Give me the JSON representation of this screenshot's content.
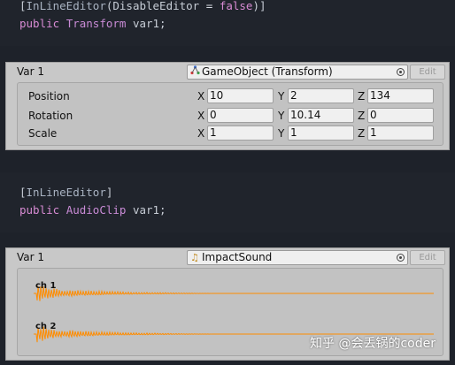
{
  "code1": {
    "attribute": "InLineEditor",
    "param_name": "DisableEditor",
    "param_op": "=",
    "param_value": "false",
    "keyword": "public",
    "type": "Transform",
    "var": "var1;"
  },
  "panel1": {
    "label": "Var 1",
    "object_field": "GameObject (Transform)",
    "object_icon": "transform-icon",
    "edit_label": "Edit",
    "rows": [
      {
        "label": "Position",
        "x": "10",
        "y": "2",
        "z": "134"
      },
      {
        "label": "Rotation",
        "x": "0",
        "y": "10.14",
        "z": "0"
      },
      {
        "label": "Scale",
        "x": "1",
        "y": "1",
        "z": "1"
      }
    ],
    "axes": {
      "x": "X",
      "y": "Y",
      "z": "Z"
    }
  },
  "code2": {
    "attribute": "InLineEditor",
    "keyword": "public",
    "type": "AudioClip",
    "var": "var1;"
  },
  "panel2": {
    "label": "Var 1",
    "object_field": "ImpactSound",
    "object_icon": "audio-note-icon",
    "edit_label": "Edit",
    "channels": [
      "ch 1",
      "ch 2"
    ],
    "wave_color": "#ff8c00"
  },
  "watermark": "知乎 @会丢锅的coder"
}
